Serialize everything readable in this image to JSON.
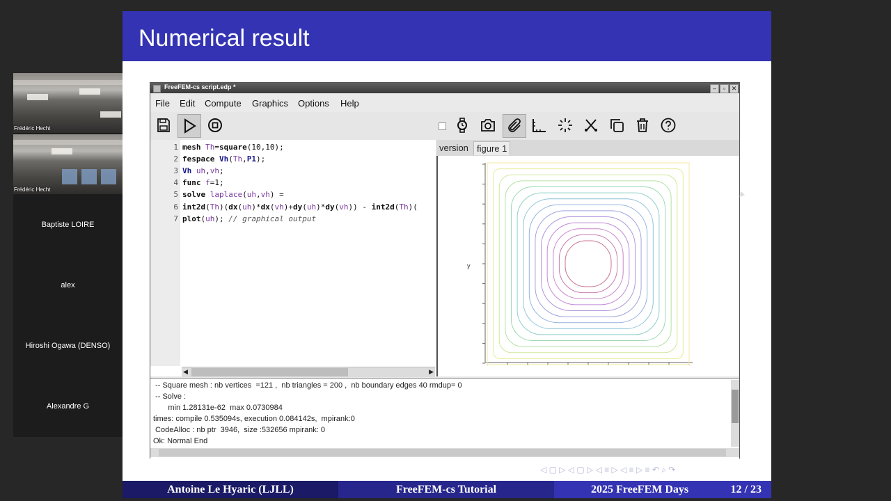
{
  "sidebar": {
    "videos": [
      {
        "name": "Frédéric Hecht"
      },
      {
        "name": "Frédéric Hecht"
      }
    ],
    "participants": [
      "Baptiste LOIRE",
      "alex",
      "Hiroshi Ogawa (DENSO)",
      "Alexandre G"
    ]
  },
  "slide": {
    "title": "Numerical result",
    "footer": {
      "author": "Antoine Le Hyaric  (LJLL)",
      "talk": "FreeFEM-cs Tutorial",
      "event": "2025 FreeFEM Days",
      "page": "12 / 23"
    }
  },
  "window": {
    "title": "FreeFEM-cs script.edp *",
    "menu": [
      "File",
      "Edit",
      "Compute",
      "Graphics",
      "Options",
      "Help"
    ],
    "toolbar_icons": [
      "save-icon",
      "run-icon",
      "stop-icon",
      "checkbox",
      "watch-icon",
      "camera-icon",
      "attach-icon",
      "ruler-icon",
      "spinner-icon",
      "scissors-icon",
      "copy-icon",
      "trash-icon",
      "help-icon"
    ],
    "editor_lines": [
      {
        "n": "1",
        "text": "mesh Th=square(10,10);"
      },
      {
        "n": "2",
        "text": "fespace Vh(Th,P1);"
      },
      {
        "n": "3",
        "text": "Vh uh,vh;"
      },
      {
        "n": "4",
        "text": "func f=1;"
      },
      {
        "n": "5",
        "text": "solve laplace(uh,vh) ="
      },
      {
        "n": "6",
        "text": "int2d(Th)(dx(uh)*dx(vh)+dy(uh)*dy(vh)) - int2d(Th)("
      },
      {
        "n": "7",
        "text": "plot(uh); // graphical output"
      }
    ],
    "tabs": [
      "version",
      "figure 1"
    ],
    "selected_tab": "figure 1",
    "plot": {
      "ylabel": "y"
    },
    "console": [
      " -- Square mesh : nb vertices  =121 ,  nb triangles = 200 ,  nb boundary edges 40 rmdup= 0",
      " -- Solve :",
      "       min 1.28131e-62  max 0.0730984",
      "times: compile 0.535094s, execution 0.084142s,  mpirank:0",
      " CodeAlloc : nb ptr  3946,  size :532656 mpirank: 0",
      "Ok: Normal End"
    ]
  },
  "nav": {
    "symbols": "◁ ▢ ▷ ◁ ▢ ▷ ◁ ≡ ▷ ◁ ≡ ▷   ≡   ↶ ⌕ ↷"
  }
}
